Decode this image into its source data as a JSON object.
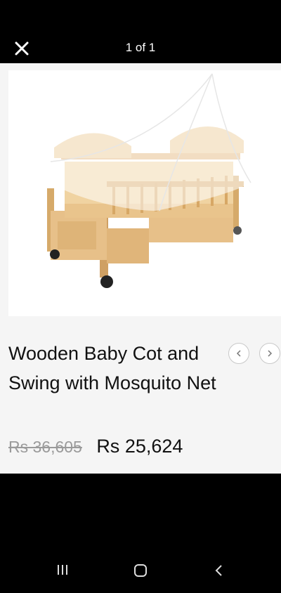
{
  "header": {
    "counter": "1 of 1",
    "close_icon": "close-icon"
  },
  "product": {
    "image_alt": "Wooden baby cot with mosquito net",
    "title": "Wooden Baby Cot and Swing with Mosquito Net",
    "original_price": "Rs 36,605",
    "sale_price": "Rs 25,624"
  },
  "carousel": {
    "prev_icon": "chevron-left-icon",
    "next_icon": "chevron-right-icon"
  },
  "system_nav": {
    "recents_icon": "recents-icon",
    "home_icon": "home-icon",
    "back_icon": "back-icon"
  },
  "colors": {
    "background": "#000000",
    "content_bg": "#f5f5f5",
    "text": "#111111",
    "strike_text": "#9a9a9a"
  }
}
